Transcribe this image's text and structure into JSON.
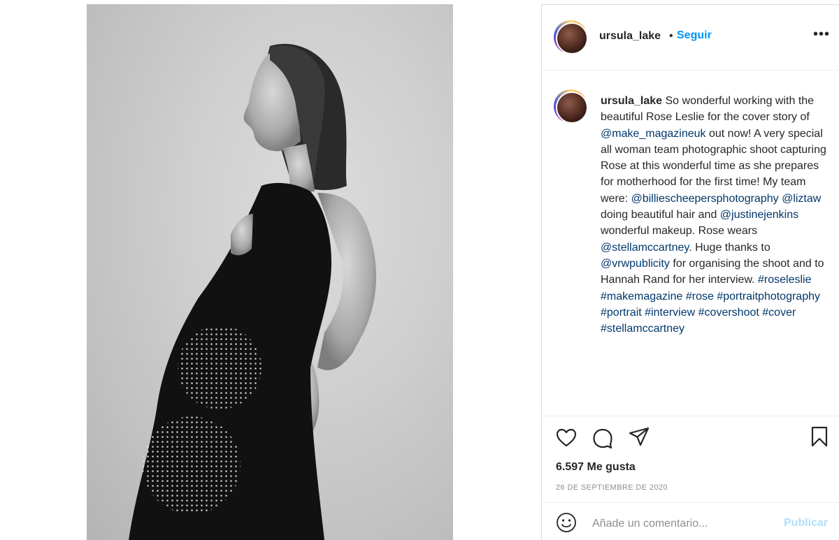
{
  "post": {
    "username": "ursula_lake",
    "dot": "•",
    "follow_label": "Seguir",
    "more_icon": "more-horizontal-icon",
    "more_glyph": "•••"
  },
  "photo": {
    "description_icon": "photo-image"
  },
  "caption": {
    "username": "ursula_lake",
    "segments": [
      {
        "text": " So wonderful working with the beautiful Rose Leslie for the cover story of ",
        "type": "text"
      },
      {
        "text": "@make_magazineuk",
        "type": "mention"
      },
      {
        "text": " out now! A very special all woman team photographic shoot capturing Rose at this wonderful time as she prepares for motherhood for the first time! My team were: ",
        "type": "text"
      },
      {
        "text": "@billiescheepersphotography",
        "type": "mention"
      },
      {
        "text": " ",
        "type": "text"
      },
      {
        "text": "@liztaw",
        "type": "mention"
      },
      {
        "text": " doing beautiful hair and ",
        "type": "text"
      },
      {
        "text": "@justinejenkins",
        "type": "mention"
      },
      {
        "text": " wonderful makeup. Rose wears ",
        "type": "text"
      },
      {
        "text": "@stellamccartney",
        "type": "mention"
      },
      {
        "text": ". Huge thanks to ",
        "type": "text"
      },
      {
        "text": "@vrwpublicity",
        "type": "mention"
      },
      {
        "text": " for organising the shoot and to Hannah Rand for her interview. ",
        "type": "text"
      },
      {
        "text": "#roseleslie",
        "type": "mention"
      },
      {
        "text": " ",
        "type": "text"
      },
      {
        "text": "#makemagazine",
        "type": "mention"
      },
      {
        "text": " ",
        "type": "text"
      },
      {
        "text": "#rose",
        "type": "mention"
      },
      {
        "text": " ",
        "type": "text"
      },
      {
        "text": "#portraitphotography",
        "type": "mention"
      },
      {
        "text": " ",
        "type": "text"
      },
      {
        "text": "#portrait",
        "type": "mention"
      },
      {
        "text": " ",
        "type": "text"
      },
      {
        "text": "#interview",
        "type": "mention"
      },
      {
        "text": " ",
        "type": "text"
      },
      {
        "text": "#covershoot",
        "type": "mention"
      },
      {
        "text": " ",
        "type": "text"
      },
      {
        "text": "#cover",
        "type": "mention"
      },
      {
        "text": " ",
        "type": "text"
      },
      {
        "text": "#stellamccartney",
        "type": "mention"
      }
    ]
  },
  "actions": {
    "like_icon": "heart-icon",
    "comment_icon": "comment-bubble-icon",
    "share_icon": "paper-plane-icon",
    "save_icon": "bookmark-icon",
    "likes_text": "6.597 Me gusta",
    "date": "26 DE SEPTIEMBRE DE 2020"
  },
  "comment_bar": {
    "emoji_icon": "emoji-smile-icon",
    "placeholder": "Añade un comentario...",
    "publish_label": "Publicar"
  },
  "colors": {
    "mention": "#00376b",
    "follow": "#0095f6",
    "publish_disabled": "#b2dffc",
    "secondary_text": "#8e8e8e"
  }
}
